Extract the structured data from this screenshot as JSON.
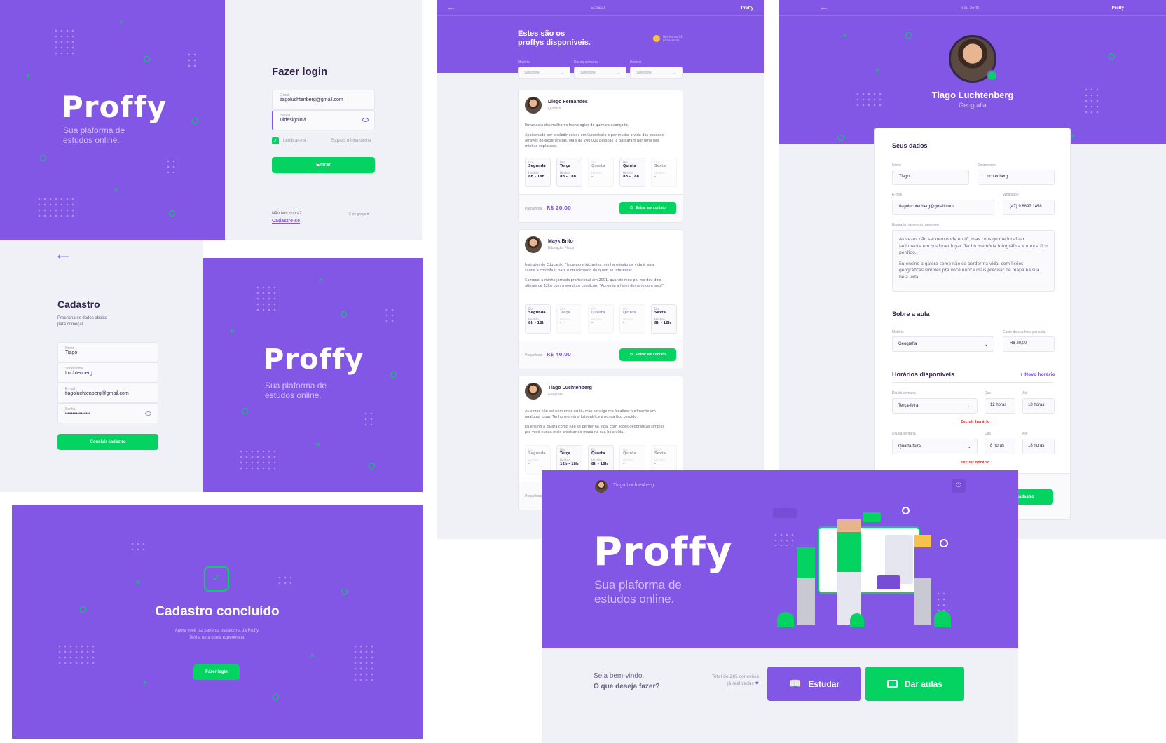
{
  "brand": {
    "logo": "Proffy",
    "tagline_line1": "Sua plaforma de",
    "tagline_line2": "estudos online."
  },
  "login": {
    "title": "Fazer login",
    "email_label": "E-mail",
    "email_value": "tiagoluchtenberg@gmail.com",
    "password_label": "Senha",
    "password_value": "uidesignlovl",
    "remember_label": "Lembrar-me",
    "forgot_label": "Esqueci minha senha",
    "submit_label": "Entrar",
    "no_account": "Não tem conta?",
    "signup_link": "Cadastre-se",
    "free_label": "É de graça"
  },
  "signup": {
    "title": "Cadastro",
    "subtitle_line1": "Preencha os dados abaixo",
    "subtitle_line2": "para começar.",
    "fields": [
      {
        "label": "Nome",
        "value": "Tiago"
      },
      {
        "label": "Sobrenome",
        "value": "Luchtenberg"
      },
      {
        "label": "E-mail",
        "value": "tiagoluchtenberg@gmail.com"
      },
      {
        "label": "Senha",
        "value": "••••••••••••••••••••"
      }
    ],
    "submit_label": "Concluir cadastro"
  },
  "success": {
    "title": "Cadastro concluído",
    "line1": "Agora você faz parte da plataforma da Proffy.",
    "line2": "Tenha uma ótima experiência.",
    "button_label": "Fazer login"
  },
  "study": {
    "header_title": "Estudar",
    "header_logo": "Proffy",
    "title_line1": "Estes são os",
    "title_line2": "proffys disponíveis.",
    "badge_line1": "Nós temos 32",
    "badge_line2": "professores.",
    "filters": [
      {
        "label": "Matéria",
        "value": "Selecione"
      },
      {
        "label": "Dia da semana",
        "value": "Selecione"
      },
      {
        "label": "Horário",
        "value": "Selecione"
      }
    ],
    "day_label": "Dia",
    "hour_label": "Horário",
    "price_label": "Preço/hora",
    "contact_label": "Entrar em contato",
    "teachers": [
      {
        "name": "Diego Fernandes",
        "subject": "Química",
        "bio1": "Entusiasta das melhores tecnologias de química avançada.",
        "bio2": "Apaixonado por explodir coisas em laboratório e por mudar a vida das pessoas através de experiências. Mais de 200.000 pessoas já passaram por uma das minhas explosões.",
        "price": "R$ 20,00",
        "days": [
          {
            "day": "Segunda",
            "hour": "8h - 18h",
            "on": true
          },
          {
            "day": "Terça",
            "hour": "8h - 18h",
            "on": true
          },
          {
            "day": "Quarta",
            "hour": "-",
            "on": false
          },
          {
            "day": "Quinta",
            "hour": "8h - 18h",
            "on": true
          },
          {
            "day": "Sexta",
            "hour": "-",
            "on": false
          }
        ]
      },
      {
        "name": "Mayk Brito",
        "subject": "Educação Física",
        "bio1": "Instrutor de Educação Física para iniciantes, minha missão de vida é levar saúde e contribuir para o crescimento de quem se interessar.",
        "bio2": "Comecei a minha jornada profissional em 2001, quando meu pai me deu dois alteres de 32kg com a seguinte condição: \"Aprenda a fazer dinheiro com isso!\"",
        "price": "R$ 40,00",
        "days": [
          {
            "day": "Segunda",
            "hour": "8h - 18h",
            "on": true
          },
          {
            "day": "Terça",
            "hour": "-",
            "on": false
          },
          {
            "day": "Quarta",
            "hour": "-",
            "on": false
          },
          {
            "day": "Quinta",
            "hour": "-",
            "on": false
          },
          {
            "day": "Sexta",
            "hour": "8h - 12h",
            "on": true
          }
        ]
      },
      {
        "name": "Tiago Luchtenberg",
        "subject": "Geografia",
        "bio1": "As vezes não sei nem onde eu tô, mas consigo me localizar facilmente em qualquer lugar. Tenho memória fotográfica e nunca fico perdido.",
        "bio2": "Eu ensino a galera como não se perder na vida, com lições geográficas simples pra você nunca mais precisar de mapa na sua bela vida.",
        "price": "",
        "days": [
          {
            "day": "Segunda",
            "hour": "-",
            "on": false
          },
          {
            "day": "Terça",
            "hour": "12h - 18h",
            "on": true
          },
          {
            "day": "Quarta",
            "hour": "8h - 18h",
            "on": true
          },
          {
            "day": "Quinta",
            "hour": "-",
            "on": false
          },
          {
            "day": "Sexta",
            "hour": "-",
            "on": false
          }
        ]
      }
    ]
  },
  "profile": {
    "header_title": "Meu perfil",
    "header_logo": "Proffy",
    "name": "Tiago Luchtenberg",
    "subject": "Geografia",
    "section_data": "Seus dados",
    "name_label": "Nome",
    "name_value": "Tiago",
    "surname_label": "Sobrenome",
    "surname_value": "Luchtenberg",
    "email_label": "E-mail",
    "email_value": "tiagoluchtenberg@gmail.com",
    "whatsapp_label": "Whatsapp",
    "whatsapp_value": "(47)  9 8897 1458",
    "bio_label": "Biografia",
    "bio_hint": "(Máximo 300 caracteres)",
    "bio_p1": "As vezes não sei nem onde eu tô, mas consigo me localizar facilmente em qualquer lugar. Tenho memória fotográfica e nunca fico perdido.",
    "bio_p2": "Eu ensino a galera como não se perder na vida, com lições geográficas simples pra você nunca mais precisar de mapa na sua bela vida.",
    "section_class": "Sobre a aula",
    "subject_label": "Matéria",
    "subject_value": "Geografia",
    "cost_label": "Custo da sua hora por aula",
    "cost_value": "R$ 20,00",
    "section_schedule": "Horários disponíveis",
    "new_schedule": "+ Novo horário",
    "weekday_label": "Dia da semana",
    "from_label": "Das",
    "to_label": "Até",
    "schedules": [
      {
        "day": "Terça-feira",
        "from": "12 horas",
        "to": "18 horas"
      },
      {
        "day": "Quarta-feira",
        "from": "8 horas",
        "to": "18 horas"
      }
    ],
    "delete_label": "Excluir horário",
    "save_label": "var cadastro"
  },
  "landing": {
    "user_name": "Tiago Luchtenberg",
    "welcome": "Seja bem-vindo.",
    "question": "O que deseja fazer?",
    "total_line1": "Total de 285 conexões",
    "total_line2": "já realizadas",
    "study_label": "Estudar",
    "teach_label": "Dar aulas"
  },
  "colors": {
    "purple": "#8257e5",
    "green": "#04d361",
    "bg": "#f0f0f7",
    "text": "#32264d"
  }
}
